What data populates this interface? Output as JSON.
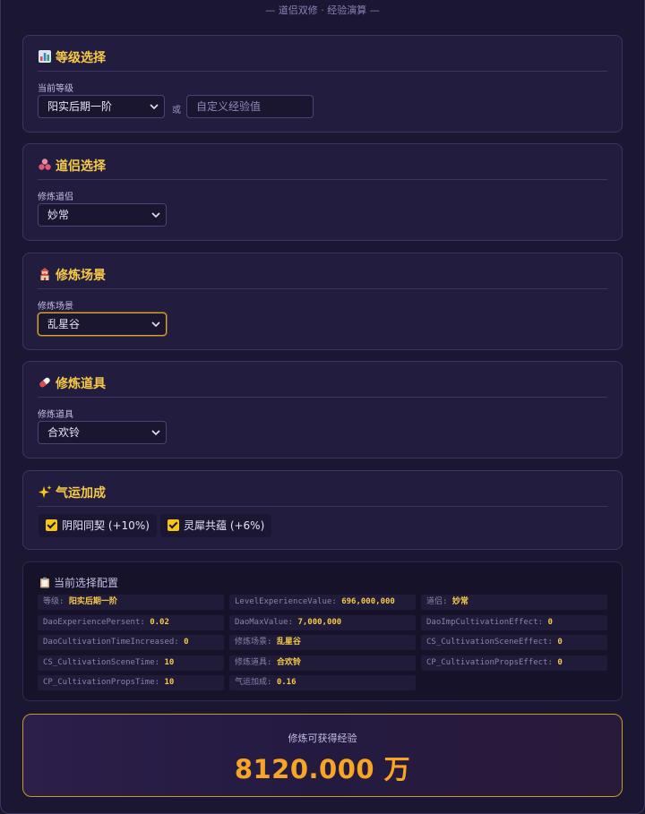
{
  "header": {
    "title": "— 道侣双修 · 经验演算 —"
  },
  "level_card": {
    "title": "等级选择",
    "field_label": "当前等级",
    "selected": "阳实后期一阶",
    "or_text": "或",
    "custom_placeholder": "自定义经验值"
  },
  "partner_card": {
    "title": "道侣选择",
    "field_label": "修炼道侣",
    "selected": "妙常"
  },
  "scene_card": {
    "title": "修炼场景",
    "field_label": "修炼场景",
    "selected": "乱星谷"
  },
  "props_card": {
    "title": "修炼道具",
    "field_label": "修炼道具",
    "selected": "合欢铃"
  },
  "luck_card": {
    "title": "气运加成",
    "options": [
      {
        "label": "阴阳同契 (+10%)",
        "checked": true
      },
      {
        "label": "灵犀共蕴 (+6%)",
        "checked": true
      }
    ]
  },
  "summary": {
    "title": "当前选择配置",
    "items": [
      {
        "key": "等级: ",
        "value": "阳实后期一阶"
      },
      {
        "key": "LevelExperienceValue: ",
        "value": "696,000,000"
      },
      {
        "key": "道侣: ",
        "value": "妙常"
      },
      {
        "key": "DaoExperiencePersent: ",
        "value": "0.02"
      },
      {
        "key": "DaoMaxValue: ",
        "value": "7,000,000"
      },
      {
        "key": "DaoImpCultivationEffect: ",
        "value": "0"
      },
      {
        "key": "DaoCultivationTimeIncreased: ",
        "value": "0"
      },
      {
        "key": "修炼场景: ",
        "value": "乱星谷"
      },
      {
        "key": "CS_CultivationSceneEffect: ",
        "value": "0"
      },
      {
        "key": "CS_CultivationSceneTime: ",
        "value": "10"
      },
      {
        "key": "修炼道具: ",
        "value": "合欢铃"
      },
      {
        "key": "CP_CultivationPropsEffect: ",
        "value": "0"
      },
      {
        "key": "CP_CultivationPropsTime: ",
        "value": "10"
      },
      {
        "key": "气运加成: ",
        "value": "0.16"
      }
    ]
  },
  "result": {
    "label": "修炼可获得经验",
    "value": "8120.000 万"
  },
  "colors": {
    "accent": "#f7c948",
    "result": "#f6a524",
    "bg": "#1b1733"
  }
}
